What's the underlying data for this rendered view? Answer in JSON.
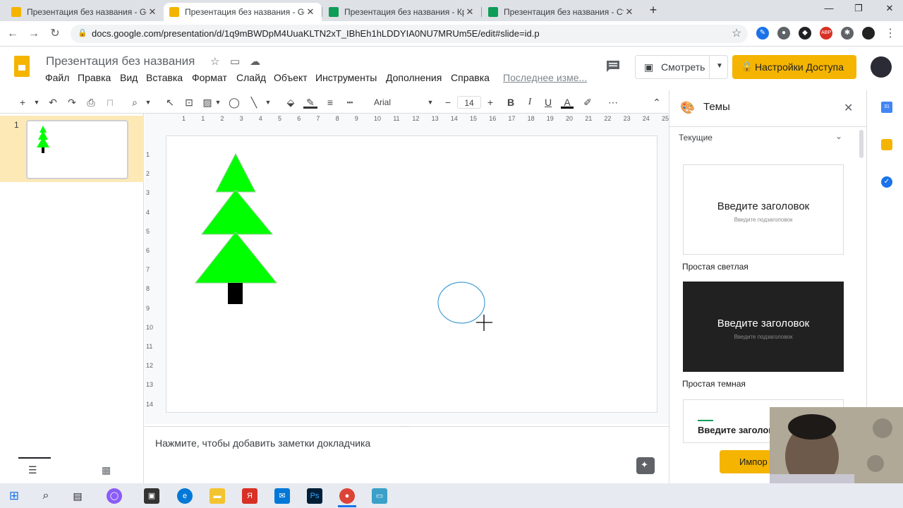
{
  "browser": {
    "tabs": [
      {
        "title": "Презентация без названия - Go",
        "color": "#f4b400",
        "active": false
      },
      {
        "title": "Презентация без названия - Go",
        "color": "#f4b400",
        "active": true
      },
      {
        "title": "Презентация без названия - Кр",
        "color": "#0f9d58",
        "active": false
      },
      {
        "title": "Презентация без названия - Ст",
        "color": "#0f9d58",
        "active": false
      }
    ],
    "new_tab": "+",
    "url": "docs.google.com/presentation/d/1q9mBWDpM4UuaKLTN2xT_IBhEh1hLDDYIA0NU7MRUm5E/edit#slide=id.p"
  },
  "doc": {
    "title": "Презентация без названия",
    "menu": [
      "Файл",
      "Правка",
      "Вид",
      "Вставка",
      "Формат",
      "Слайд",
      "Объект",
      "Инструменты",
      "Дополнения",
      "Справка"
    ],
    "last_edit": "Последнее изме...",
    "present_label": "Смотреть",
    "share_label": "Настройки Доступа"
  },
  "toolbar": {
    "font": "Arial",
    "font_size": "14"
  },
  "filmstrip": {
    "slide_number": "1"
  },
  "ruler": {
    "top": [
      "1",
      "1",
      "2",
      "3",
      "4",
      "5",
      "6",
      "7",
      "8",
      "9",
      "10",
      "11",
      "12",
      "13",
      "14",
      "15",
      "16",
      "17",
      "18",
      "19",
      "20",
      "21",
      "22",
      "23",
      "24",
      "25"
    ],
    "left": [
      "1",
      "2",
      "3",
      "4",
      "5",
      "6",
      "7",
      "8",
      "9",
      "10",
      "11",
      "12",
      "13",
      "14"
    ]
  },
  "notes": {
    "placeholder": "Нажмите, чтобы добавить заметки докладчика"
  },
  "themes_panel": {
    "title": "Темы",
    "current_label": "Текущие",
    "themes": [
      {
        "heading": "Введите заголовок",
        "subheading": "Введите подзаголовок",
        "name": "Простая светлая",
        "bg": "#ffffff",
        "fg": "#202124"
      },
      {
        "heading": "Введите заголовок",
        "subheading": "Введите подзаголовок",
        "name": "Простая темная",
        "bg": "#212121",
        "fg": "#ffffff"
      },
      {
        "heading": "Введите заголовок",
        "subheading": "",
        "name": "",
        "bg": "#ffffff",
        "fg": "#202124"
      }
    ],
    "import_label": "Импор"
  },
  "colors": {
    "tree_green": "#00ff00",
    "trunk": "#000000",
    "accent": "#f4b400",
    "ellipse_stroke": "#4a9fd5"
  }
}
